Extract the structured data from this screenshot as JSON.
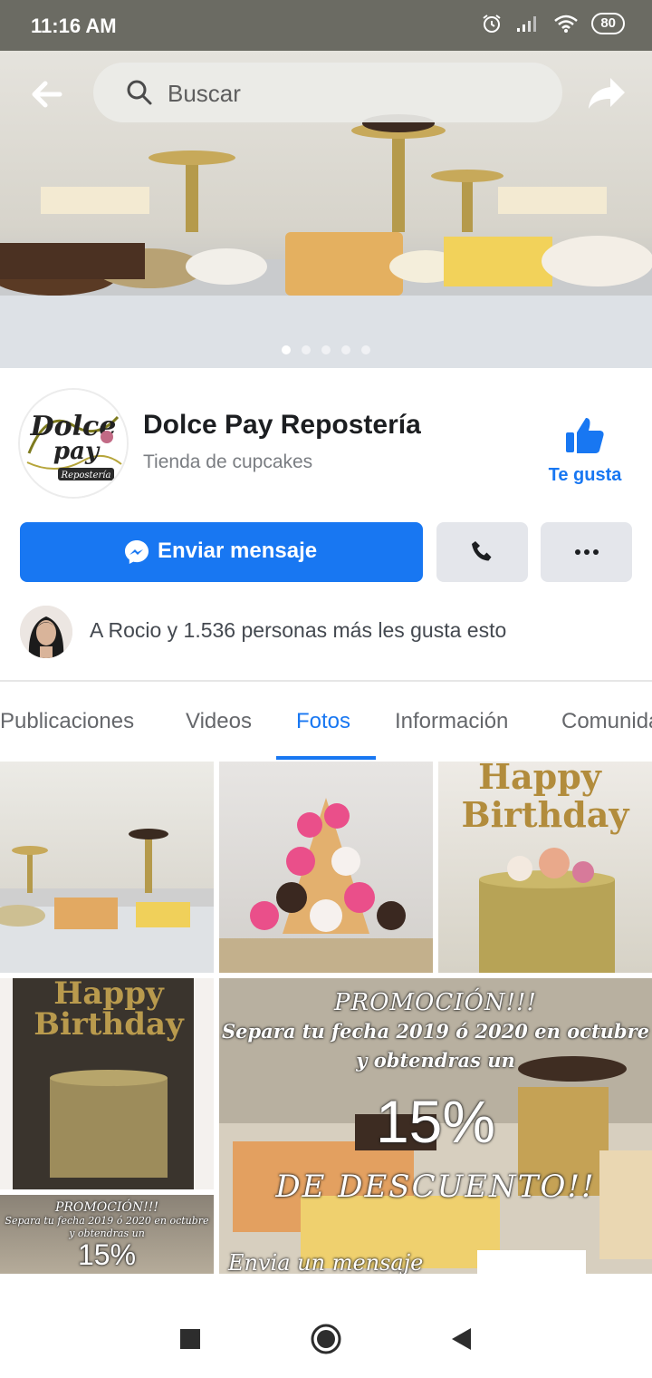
{
  "status_bar": {
    "time": "11:16 AM",
    "battery": "80"
  },
  "search": {
    "placeholder": "Buscar"
  },
  "page": {
    "name": "Dolce Pay Repostería",
    "category": "Tienda de cupcakes",
    "logo_text": "Dolce Pay",
    "logo_sub": "Repostería"
  },
  "actions": {
    "like_label": "Te gusta",
    "message_label": "Enviar mensaje"
  },
  "social_proof": "A Rocio y 1.536 personas más les gusta esto",
  "tabs": [
    "Publicaciones",
    "Videos",
    "Fotos",
    "Información",
    "Comunidad"
  ],
  "active_tab": "Fotos",
  "cover_dots": {
    "count": 5,
    "active_index": 0
  },
  "photos": {
    "p3_text_1": "Happy",
    "p3_text_2": "Birthday",
    "p4_text_1": "Happy",
    "p4_text_2": "Birthday",
    "promo": {
      "line1": "PROMOCIÓN!!!",
      "line2": "Separa tu fecha 2019 ó 2020 en octubre",
      "line3": "y obtendras un",
      "line4": "15%",
      "line5": "DE DESCUENTO!!",
      "line6": "Envia un mensaje"
    }
  },
  "colors": {
    "brand_blue": "#1877f2",
    "button_gray": "#e4e6eb"
  }
}
